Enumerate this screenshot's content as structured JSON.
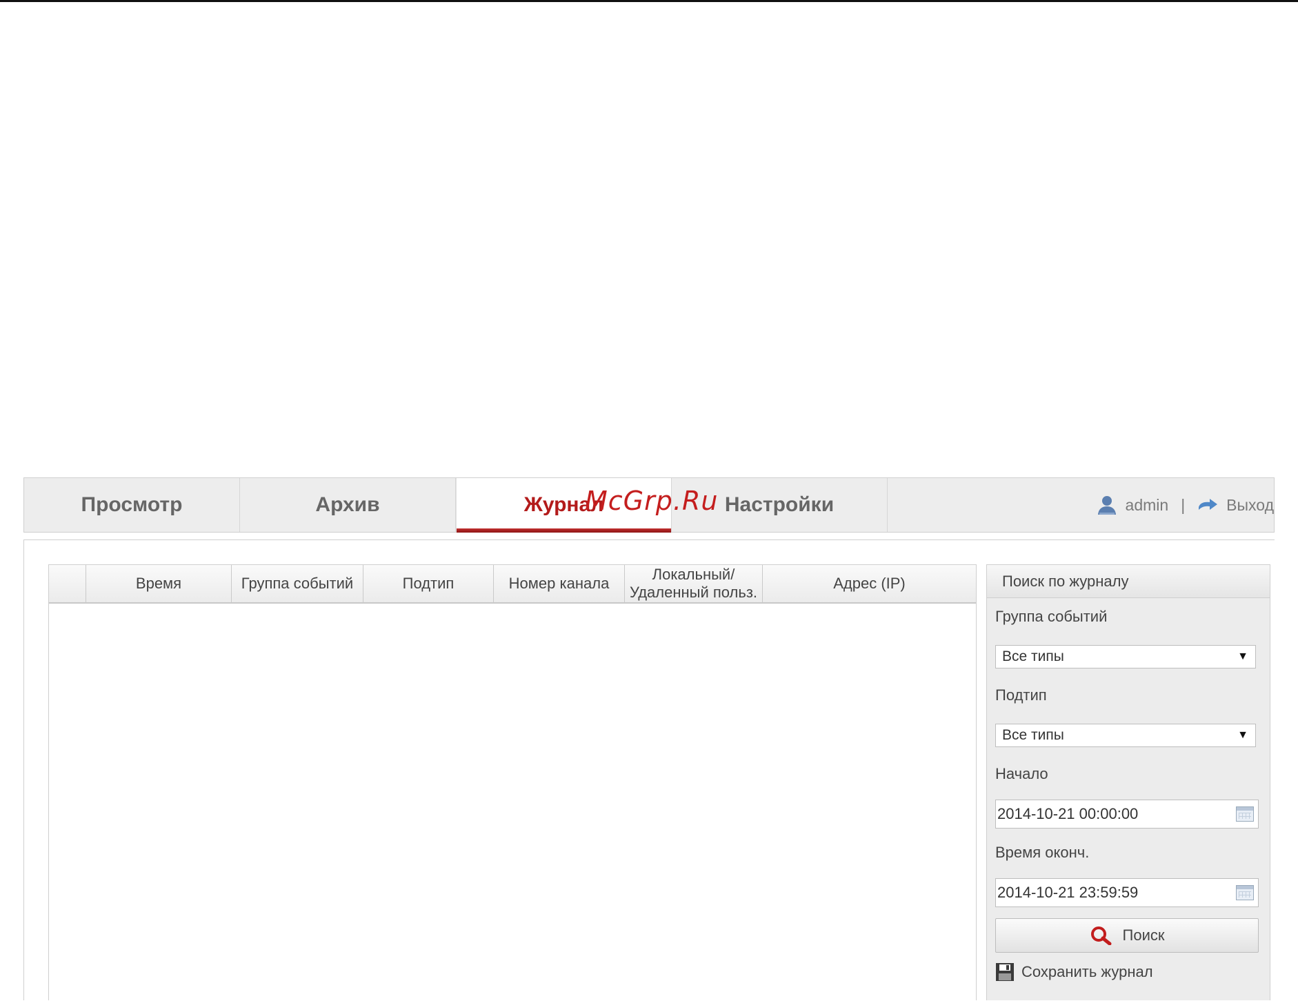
{
  "nav": {
    "tabs": [
      {
        "label": "Просмотр"
      },
      {
        "label": "Архив"
      },
      {
        "label": "Журнал"
      },
      {
        "label": "Настройки"
      }
    ],
    "watermark": "McGrp.Ru",
    "user": {
      "name": "admin",
      "separator": "|",
      "logout_label": "Выход"
    }
  },
  "table": {
    "columns": [
      "",
      "Время",
      "Группа событий",
      "Подтип",
      "Номер канала",
      "Локальный/\nУдаленный польз.",
      "Адрес (IP)"
    ],
    "rows": []
  },
  "search_panel": {
    "title": "Поиск по журналу",
    "event_group_label": "Группа событий",
    "event_group_value": "Все типы",
    "subtype_label": "Подтип",
    "subtype_value": "Все типы",
    "start_label": "Начало",
    "start_value": "2014-10-21 00:00:00",
    "end_label": "Время оконч.",
    "end_value": "2014-10-21 23:59:59",
    "search_button": "Поиск",
    "save_log": "Сохранить журнал"
  },
  "colors": {
    "accent": "#b31b1b",
    "nav_bg": "#ededed",
    "panel_bg": "#ececec"
  }
}
